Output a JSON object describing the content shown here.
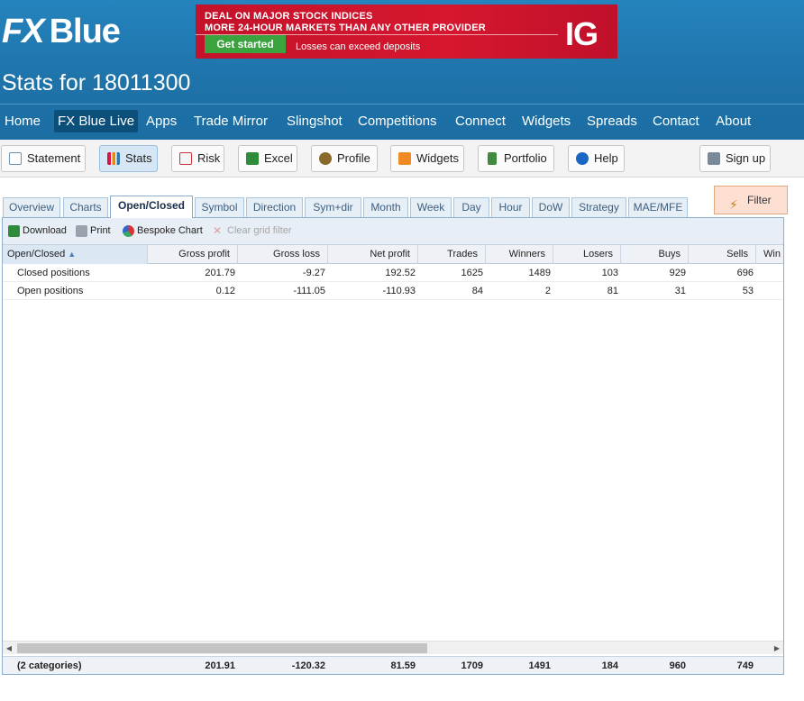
{
  "brand": {
    "fx": "FX",
    "blue": "Blue"
  },
  "ad": {
    "line1": "DEAL ON MAJOR STOCK INDICES",
    "line2": "MORE 24-HOUR MARKETS THAN ANY OTHER PROVIDER",
    "cta": "Get started",
    "warning": "Losses can exceed deposits",
    "logo": "IG"
  },
  "page": {
    "title": "Stats for 18011300"
  },
  "nav": [
    "Home",
    "FX Blue Live",
    "Apps",
    "Trade Mirror",
    "Slingshot",
    "Competitions",
    "Connect",
    "Widgets",
    "Spreads",
    "Contact",
    "About"
  ],
  "nav_active": "FX Blue Live",
  "toolbar": {
    "statement": "Statement",
    "stats": "Stats",
    "risk": "Risk",
    "excel": "Excel",
    "profile": "Profile",
    "widgets": "Widgets",
    "portfolio": "Portfolio",
    "help": "Help",
    "signup": "Sign up"
  },
  "tabs": [
    "Overview",
    "Charts",
    "Open/Closed",
    "Symbol",
    "Direction",
    "Sym+dir",
    "Month",
    "Week",
    "Day",
    "Hour",
    "DoW",
    "Strategy",
    "MAE/MFE"
  ],
  "active_tab": "Open/Closed",
  "filter": {
    "label": "Filter"
  },
  "grid_tools": {
    "download": "Download",
    "print": "Print",
    "bespoke": "Bespoke Chart",
    "clear": "Clear grid filter"
  },
  "grid": {
    "columns": [
      "Open/Closed",
      "Gross profit",
      "Gross loss",
      "Net profit",
      "Trades",
      "Winners",
      "Losers",
      "Buys",
      "Sells",
      "Win"
    ],
    "rows": [
      [
        "Closed positions",
        "201.79",
        "-9.27",
        "192.52",
        "1625",
        "1489",
        "103",
        "929",
        "696"
      ],
      [
        "Open positions",
        "0.12",
        "-111.05",
        "-110.93",
        "84",
        "2",
        "81",
        "31",
        "53"
      ]
    ],
    "totals": [
      "(2 categories)",
      "201.91",
      "-120.32",
      "81.59",
      "1709",
      "1491",
      "184",
      "960",
      "749"
    ]
  },
  "colors": {
    "header": "#1e73a9",
    "accent": "#0b4f7a",
    "ad": "#d5172f"
  }
}
